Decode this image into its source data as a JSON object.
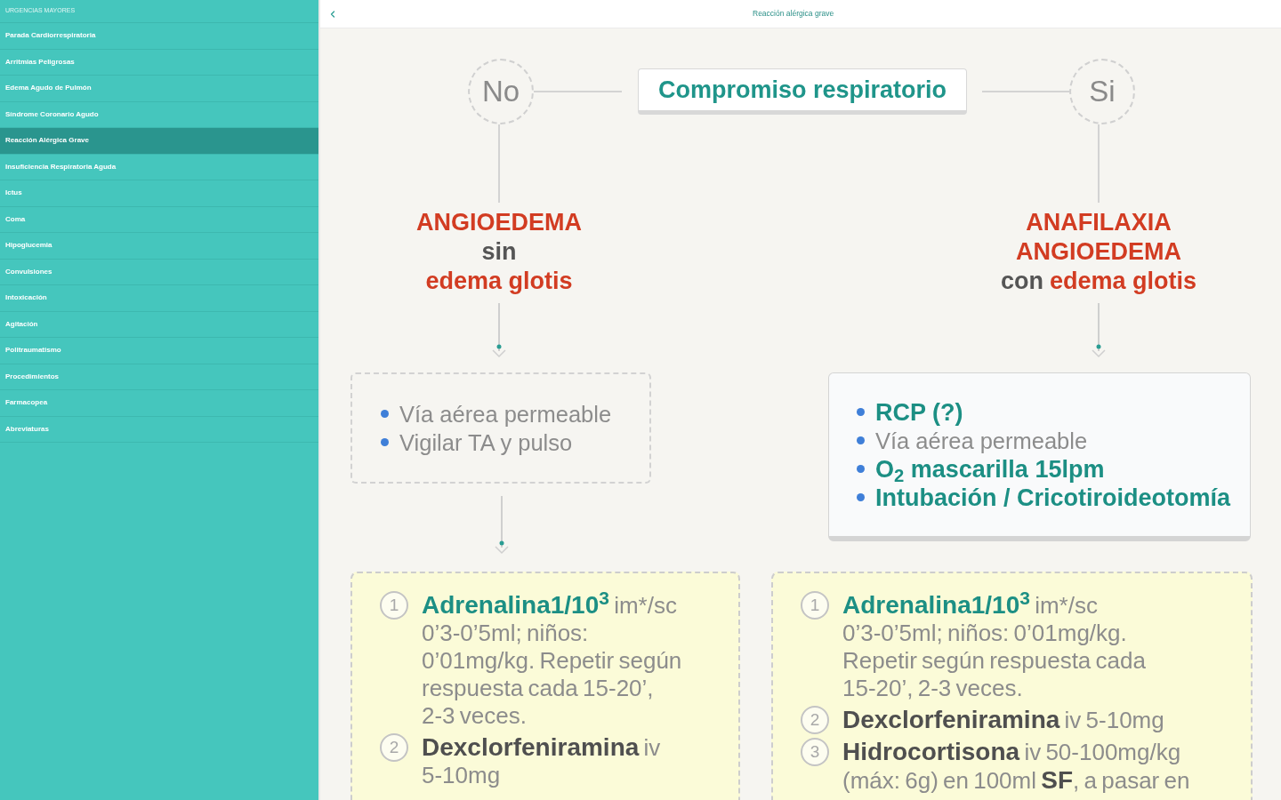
{
  "sidebar": {
    "heading": "URGENCIAS MAYORES",
    "items": [
      {
        "label": "Parada Cardiorrespiratoria",
        "selected": false
      },
      {
        "label": "Arritmias Peligrosas",
        "selected": false
      },
      {
        "label": "Edema Agudo de Pulmón",
        "selected": false
      },
      {
        "label": "Síndrome Coronario Agudo",
        "selected": false
      },
      {
        "label": "Reacción Alérgica Grave",
        "selected": true
      },
      {
        "label": "Insuficiencia Respiratoria Aguda",
        "selected": false
      },
      {
        "label": "Ictus",
        "selected": false
      },
      {
        "label": "Coma",
        "selected": false
      },
      {
        "label": "Hipoglucemia",
        "selected": false
      },
      {
        "label": "Convulsiones",
        "selected": false
      },
      {
        "label": "Intoxicación",
        "selected": false
      },
      {
        "label": "Agitación",
        "selected": false
      },
      {
        "label": "Politraumatismo",
        "selected": false
      },
      {
        "label": "Procedimientos",
        "selected": false
      },
      {
        "label": "Farmacopea",
        "selected": false
      },
      {
        "label": "Abreviaturas",
        "selected": false
      }
    ]
  },
  "header": {
    "title": "Reacción alérgica grave"
  },
  "flowchart": {
    "question": "Compromiso respiratorio",
    "branches": [
      {
        "answer": "No",
        "diagnosis": [
          [
            {
              "text": "ANGIOEDEMA",
              "alert": true
            }
          ],
          [
            {
              "text": "sin",
              "alert": false
            }
          ],
          [
            {
              "text": "edema glotis",
              "alert": true
            }
          ]
        ],
        "measures": {
          "kind": "dashed",
          "continues": true,
          "items": [
            {
              "text": "Vía aérea permeable",
              "highlighted": false
            },
            {
              "text": "Vigilar TA y pulso",
              "highlighted": false
            }
          ]
        },
        "treatment": [
          {
            "number": "1",
            "highlighted": true,
            "text": "**Adrenalina1/10$^{3}$** im*/sc 0’3-0’5ml; niños: 0’01mg/kg. Repetir según respuesta cada 15-20’, 2-3 veces."
          },
          {
            "number": "2",
            "highlighted": false,
            "text": "**Dexclorfeniramina** iv 5-10mg"
          }
        ]
      },
      {
        "answer": "Si",
        "diagnosis": [
          [
            {
              "text": "ANAFILAXIA",
              "alert": true
            }
          ],
          [
            {
              "text": "ANGIOEDEMA",
              "alert": true
            }
          ],
          [
            {
              "text": "con",
              "alert": false
            },
            {
              "text": "edema glotis",
              "alert": true
            }
          ]
        ],
        "measures": {
          "kind": "raised",
          "continues": false,
          "items": [
            {
              "text": "RCP (?)",
              "highlighted": true
            },
            {
              "text": "Vía aérea permeable",
              "highlighted": false
            },
            {
              "text": "O$_{2}$ mascarilla 15lpm",
              "highlighted": true
            },
            {
              "text": "Intubación / Cricotiroideotomía",
              "highlighted": true
            }
          ]
        },
        "treatment": [
          {
            "number": "1",
            "highlighted": true,
            "text": "**Adrenalina1/10$^{3}$** im*/sc 0’3-0’5ml; niños: 0’01mg/kg. Repetir según respuesta cada 15-20’, 2-3 veces."
          },
          {
            "number": "2",
            "highlighted": false,
            "text": "**Dexclorfeniramina** iv 5-10mg"
          },
          {
            "number": "3",
            "highlighted": false,
            "text": "**Hidrocortisona** iv 50-100mg/kg (máx: 6g) en 100ml **SF**, a pasar en"
          }
        ]
      }
    ]
  }
}
